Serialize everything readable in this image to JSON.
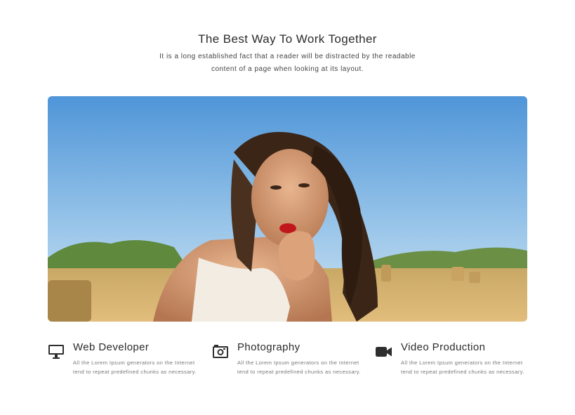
{
  "section": {
    "title": "The Best Way To Work Together",
    "subtitle": "It is a long established fact that a reader will be distracted by the readable content of a page when looking at its layout."
  },
  "hero": {
    "image_alt": "woman-in-wheat-field-photo"
  },
  "features": [
    {
      "icon": "monitor-icon",
      "title": "Web Developer",
      "text": "All the Lorem Ipsum generators on the Internet tend to repeat predefined chunks as necessary."
    },
    {
      "icon": "camera-icon",
      "title": "Photography",
      "text": "All the Lorem Ipsum generators on the Internet tend to repeat predefined chunks as necessary."
    },
    {
      "icon": "video-camera-icon",
      "title": "Video Production",
      "text": "All the Lorem Ipsum generators on the Internet tend to repeat predefined chunks as necessary."
    }
  ],
  "colors": {
    "heading": "#2b2b2b",
    "body_text": "#777777",
    "icon": "#2e2e2e",
    "sky_top": "#4f95d8",
    "field": "#d9b06a"
  }
}
